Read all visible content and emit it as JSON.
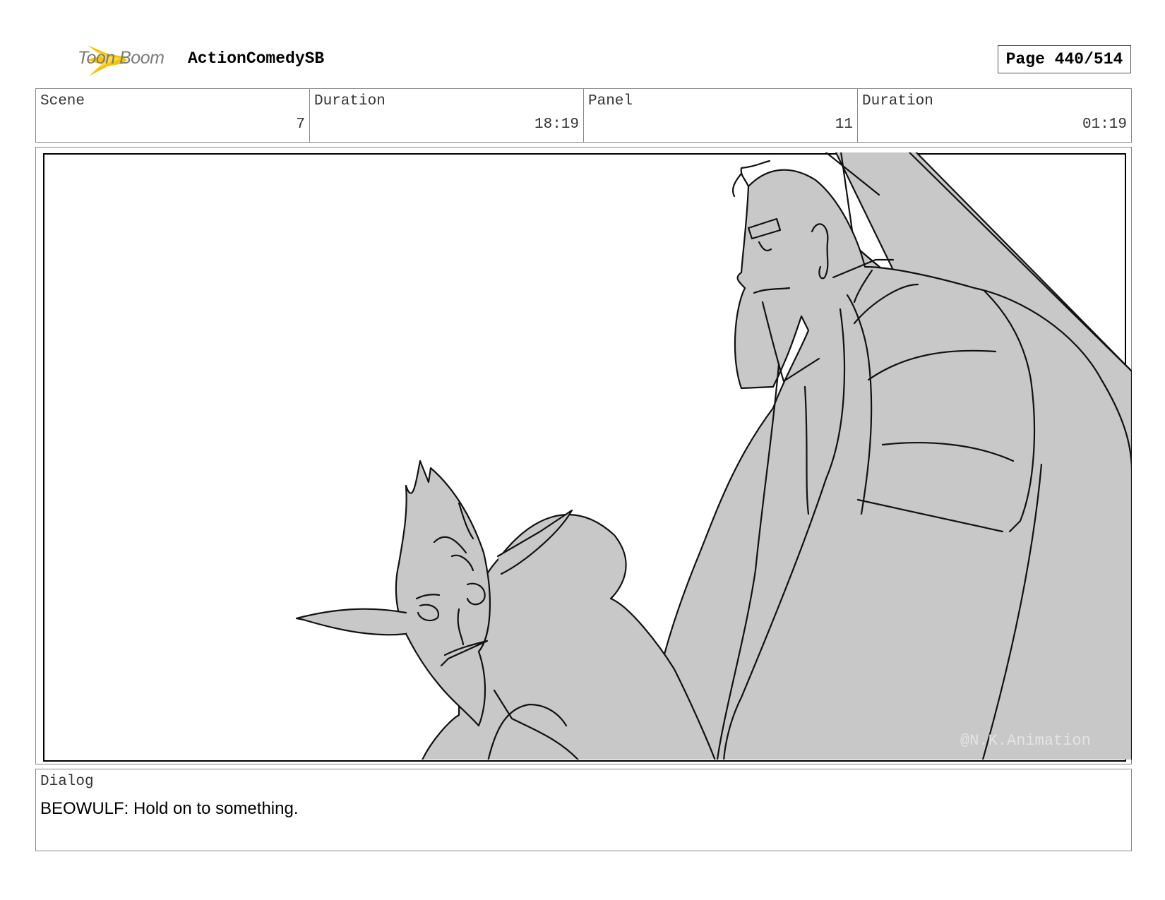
{
  "header": {
    "logo_icon": "toon-boom-star-icon",
    "logo_text": "Toon Boom",
    "project_title": "ActionComedySB",
    "page_label": "Page 440/514"
  },
  "info": {
    "scene_label": "Scene",
    "scene_value": "7",
    "scene_duration_label": "Duration",
    "scene_duration_value": "18:19",
    "panel_label": "Panel",
    "panel_value": "11",
    "panel_duration_label": "Duration",
    "panel_duration_value": "01:19"
  },
  "panel": {
    "watermark": "@N.K.Animation",
    "fill_color": "#c8c8c8"
  },
  "dialog": {
    "label": "Dialog",
    "text": "BEOWULF: Hold on to something."
  },
  "colors": {
    "logo_yellow": "#f5c500",
    "logo_text_gray": "#7a7a7a"
  }
}
